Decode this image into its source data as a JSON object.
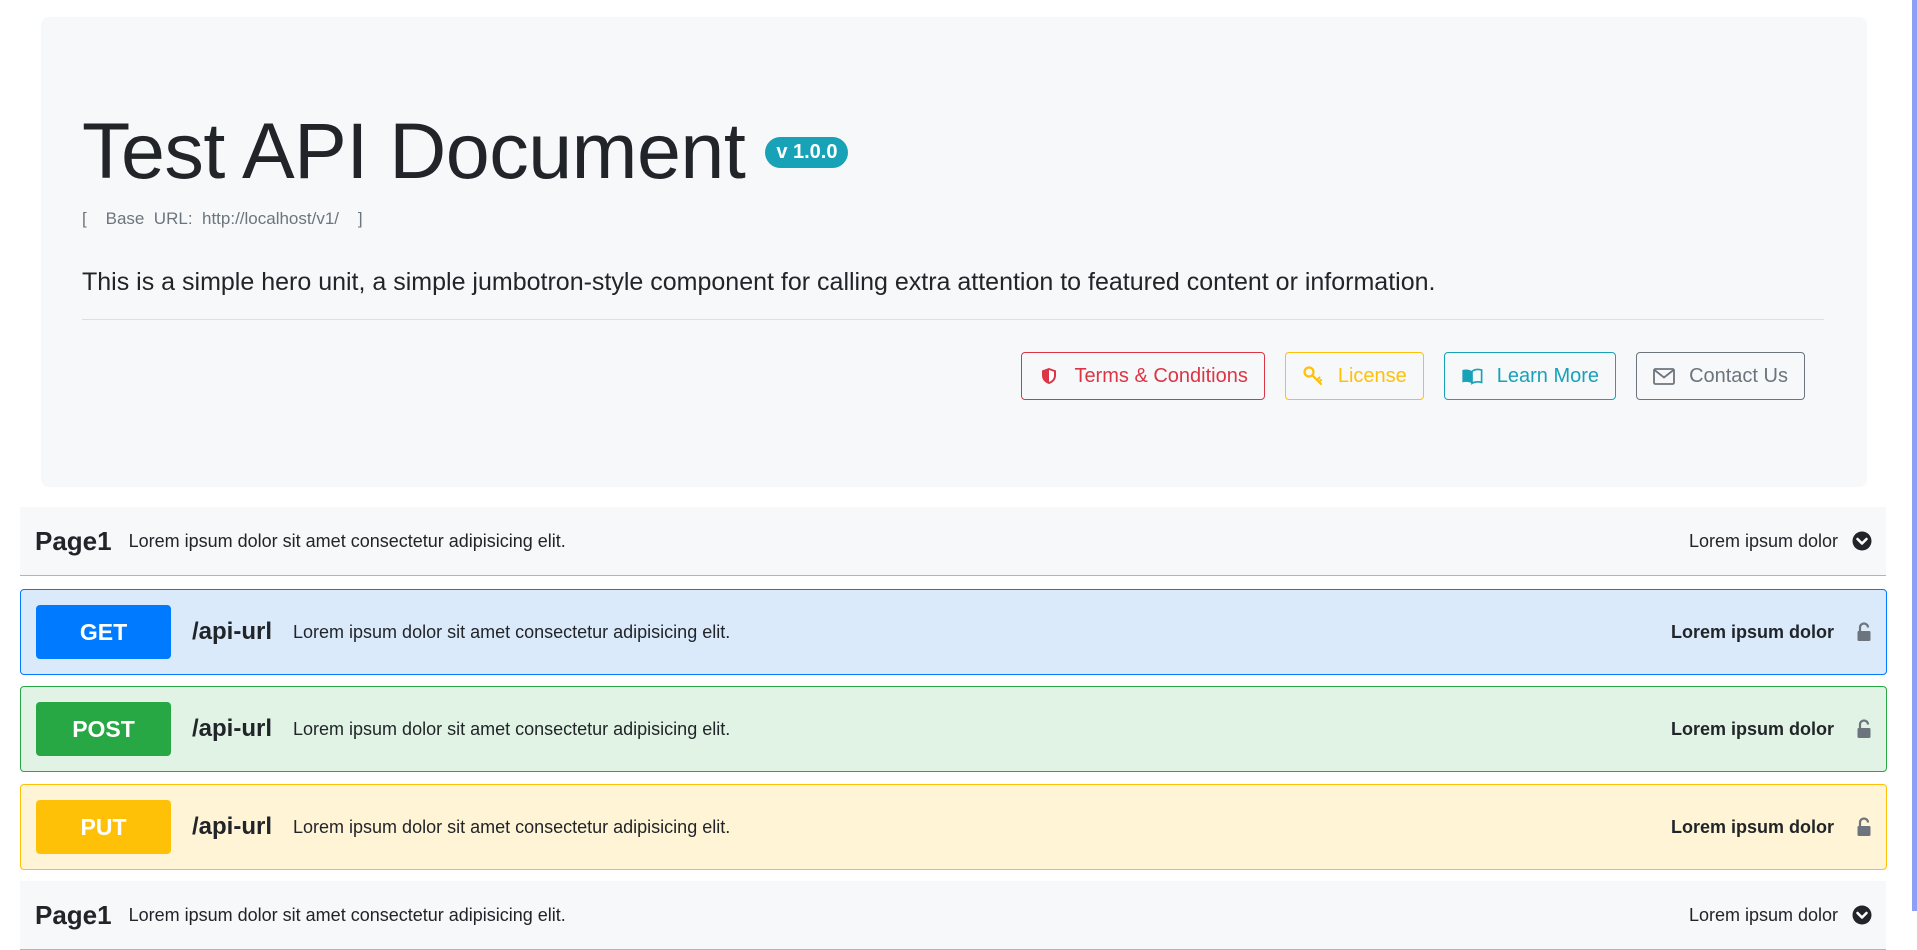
{
  "header": {
    "title": "Test API Document",
    "version": "v 1.0.0",
    "base_url": "[    Base  URL:  http://localhost/v1/    ]",
    "lead": "This is a simple hero unit, a simple jumbotron-style component for calling extra attention to featured content or information."
  },
  "buttons": {
    "terms": "Terms & Conditions",
    "license": "License",
    "learn_more": "Learn More",
    "contact": "Contact Us"
  },
  "sections": [
    {
      "name": "Page1",
      "description": "Lorem ipsum dolor sit amet consectetur adipisicing elit.",
      "right_label": "Lorem ipsum dolor"
    },
    {
      "name": "Page1",
      "description": "Lorem ipsum dolor sit amet consectetur adipisicing elit.",
      "right_label": "Lorem ipsum dolor"
    }
  ],
  "operations": [
    {
      "method": "GET",
      "path": "/api-url",
      "description": "Lorem ipsum dolor sit amet consectetur adipisicing elit.",
      "right_label": "Lorem ipsum dolor"
    },
    {
      "method": "POST",
      "path": "/api-url",
      "description": "Lorem ipsum dolor sit amet consectetur adipisicing elit.",
      "right_label": "Lorem ipsum dolor"
    },
    {
      "method": "PUT",
      "path": "/api-url",
      "description": "Lorem ipsum dolor sit amet consectetur adipisicing elit.",
      "right_label": "Lorem ipsum dolor"
    }
  ],
  "colors": {
    "get": "#007bff",
    "post": "#28a745",
    "put": "#ffc107",
    "danger": "#dc3545",
    "info": "#17a2b8",
    "secondary": "#6c757d"
  },
  "icons": {
    "terms": "shield-icon",
    "license": "key-icon",
    "learn_more": "book-icon",
    "contact": "envelope-icon",
    "section_toggle": "chevron-circle-down-icon",
    "operation": "unlock-icon"
  }
}
